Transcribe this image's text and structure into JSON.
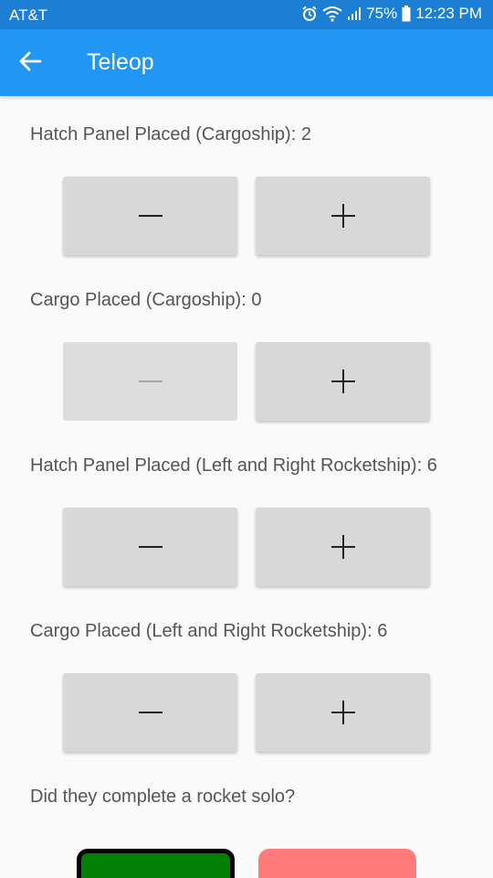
{
  "status_bar": {
    "carrier": "AT&T",
    "battery": "75%",
    "time": "12:23 PM",
    "icons": [
      "alarm-icon",
      "wifi-icon",
      "signal-icon",
      "battery-icon"
    ]
  },
  "app_bar": {
    "title": "Teleop",
    "back_icon": "arrow-left-icon",
    "color": "#2196f3"
  },
  "counters": [
    {
      "label": "Hatch Panel Placed (Cargoship): ",
      "value": "2",
      "minus_enabled": true
    },
    {
      "label": "Cargo Placed (Cargoship): ",
      "value": "0",
      "minus_enabled": false
    },
    {
      "label": "Hatch Panel Placed (Left and Right Rocketship): ",
      "value": "6",
      "minus_enabled": true
    },
    {
      "label": "Cargo Placed (Left and Right Rocketship): ",
      "value": "6",
      "minus_enabled": true
    }
  ],
  "rocket_solo": {
    "question": "Did they complete a rocket solo?",
    "yes_color": "#038003",
    "no_color": "#ff7b7b",
    "selected": "yes"
  }
}
